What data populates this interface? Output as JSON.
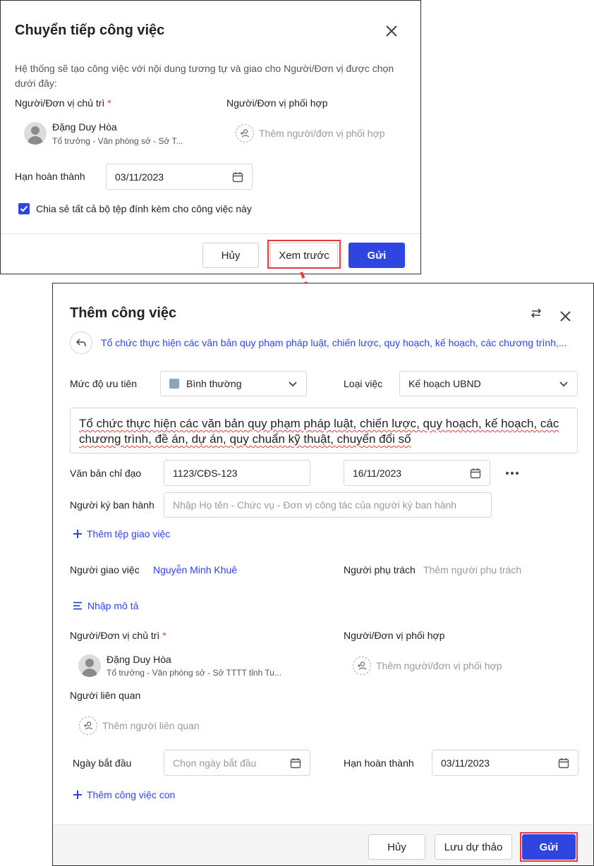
{
  "forward_dialog": {
    "title": "Chuyển tiếp công việc",
    "description": "Hệ thống sẽ tạo công việc với nội dung tương tự và giao cho Người/Đơn vị được chọn dưới đây:",
    "main_label": "Người/Đơn vị chủ trì",
    "required_mark": "*",
    "coop_label": "Người/Đơn vị phối hợp",
    "person_name": "Đặng Duy Hòa",
    "person_role": "Tổ trưởng - Văn phòng sở - Sở T...",
    "coop_placeholder": "Thêm người/đơn vị phối hợp",
    "deadline_label": "Hạn hoàn thành",
    "deadline_value": "03/11/2023",
    "share_label": "Chia sẻ tất cả bộ tệp đính kèm cho công việc này",
    "share_checked": true,
    "cancel": "Hủy",
    "preview": "Xem trước",
    "send": "Gửi"
  },
  "add_task": {
    "title": "Thêm công việc",
    "breadcrumb": "Tổ chức thực hiện các văn bản quy phạm pháp luật, chiến lược, quy hoạch, kế hoạch, các chương trình,...",
    "priority_label": "Mức độ ưu tiên",
    "priority_value": "Bình thường",
    "type_label": "Loại việc",
    "type_value": "Kế hoạch UBND",
    "task_title": "Tổ chức thực hiện các văn bản quy phạm pháp luật, chiến lược, quy hoạch, kế hoạch, các chương trình, đề án, dự án, quy chuẩn kỹ thuật, chuyển đổi số",
    "directive_label": "Văn bản chỉ đạo",
    "directive_number": "1123/CĐS-123",
    "directive_date": "16/11/2023",
    "signer_label": "Người ký ban hành",
    "signer_placeholder": "Nhập Họ tên - Chức vụ - Đơn vị công tác của người ký ban hành",
    "add_file": "Thêm tệp giao việc",
    "assigner_label": "Người giao việc",
    "assigner_value": "Nguyễn Minh Khuê",
    "owner_label": "Người phụ trách",
    "owner_placeholder": "Thêm người phụ trách",
    "desc_link": "Nhập mô tả",
    "main_label": "Người/Đơn vị chủ trì",
    "required_mark": "*",
    "coop_label": "Người/Đơn vị phối hợp",
    "person_name": "Đặng Duy Hòa",
    "person_role": "Tổ trưởng - Văn phòng sở - Sở TTTT tỉnh Tu...",
    "coop_placeholder": "Thêm người/đơn vị phối hợp",
    "related_label": "Người liên quan",
    "related_placeholder": "Thêm người liên quan",
    "start_label": "Ngày bắt đầu",
    "start_placeholder": "Chọn ngày bắt đầu",
    "deadline_label": "Hạn hoàn thành",
    "deadline_value": "03/11/2023",
    "add_subtask": "Thêm công việc con",
    "cancel": "Hủy",
    "save_draft": "Lưu dự thảo",
    "send": "Gửi"
  },
  "colors": {
    "primary": "#2f45e0",
    "highlight": "#e23b3b",
    "priority_swatch": "#8fa3bf"
  }
}
